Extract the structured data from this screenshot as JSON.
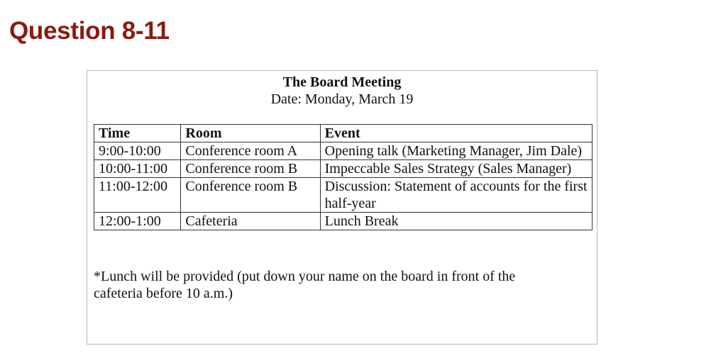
{
  "header": {
    "title": "Question 8-11"
  },
  "document": {
    "title": "The Board Meeting",
    "date": "Date: Monday, March 19",
    "columns": [
      "Time",
      "Room",
      "Event"
    ],
    "rows": [
      {
        "time": "9:00-10:00",
        "room": "Conference room A",
        "event": "Opening talk (Marketing Manager, Jim Dale)"
      },
      {
        "time": "10:00-11:00",
        "room": "Conference room B",
        "event": "Impeccable Sales Strategy (Sales Manager)"
      },
      {
        "time": "11:00-12:00",
        "room": "Conference room B",
        "event": "Discussion: Statement of accounts for the first half-year"
      },
      {
        "time": "12:00-1:00",
        "room": "Cafeteria",
        "event": "Lunch Break"
      }
    ],
    "footnote": "*Lunch will be provided (put down your name on the board in front of the cafeteria before 10 a.m.)"
  }
}
